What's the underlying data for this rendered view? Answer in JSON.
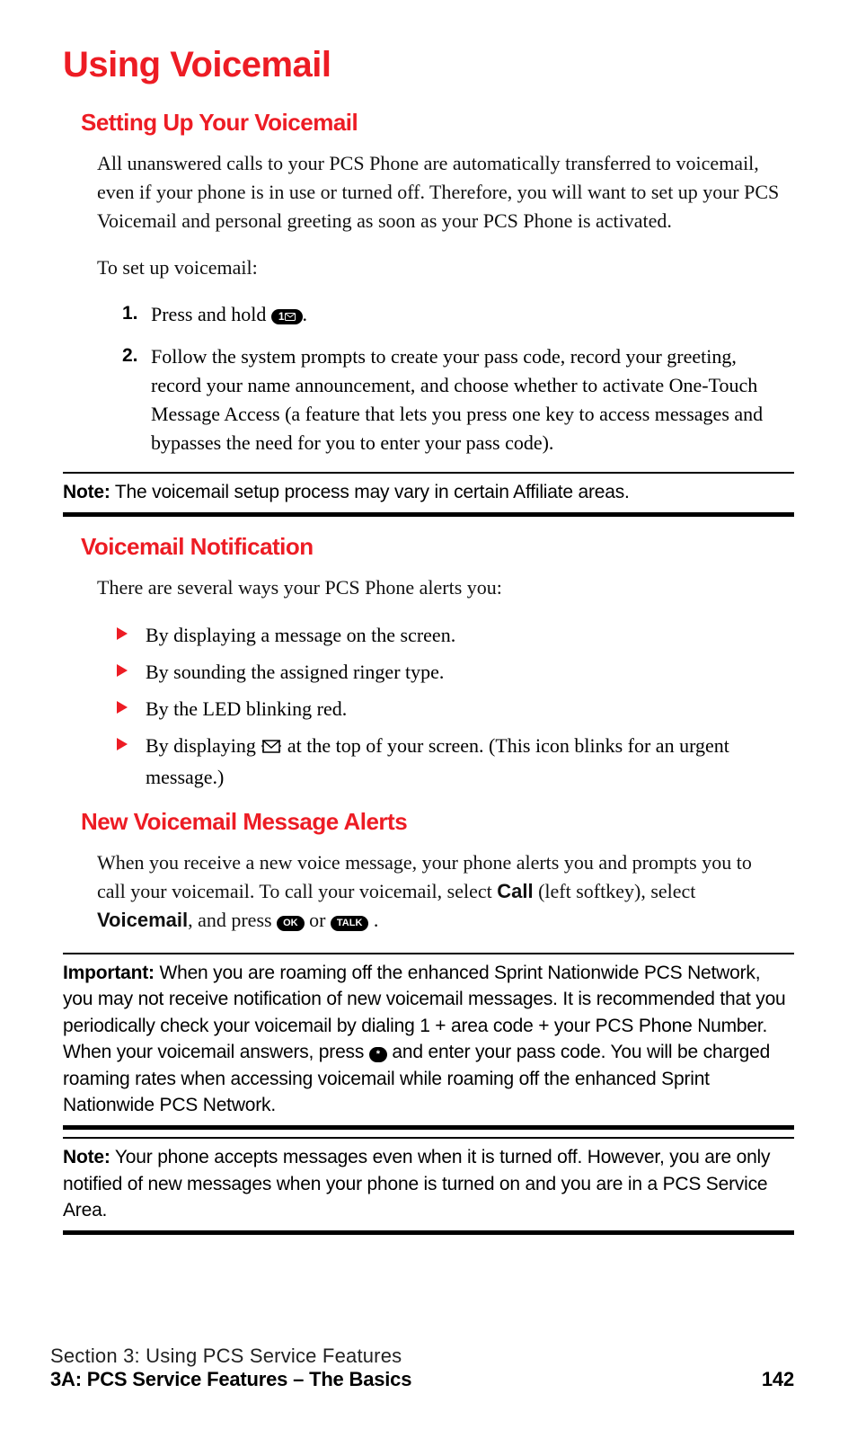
{
  "title": "Using Voicemail",
  "section1": {
    "heading": "Setting Up Your Voicemail",
    "intro": "All unanswered calls to your PCS Phone are automatically transferred to voicemail, even if your phone is in use or turned off. Therefore, you will want to set up your PCS Voicemail and personal greeting as soon as your PCS Phone is activated.",
    "lead": "To set up voicemail:",
    "steps": {
      "num1": "1.",
      "step1_a": "Press and hold ",
      "step1_key_label": "1",
      "step1_b": ".",
      "num2": "2.",
      "step2": "Follow the system prompts to create your pass code, record your greeting, record your name announcement, and choose whether to activate One-Touch Message Access (a feature that lets you press one key to access messages and bypasses the need for you to enter your pass code)."
    }
  },
  "note1": {
    "label": "Note:",
    "text": " The voicemail setup process may vary in certain Affiliate areas."
  },
  "section2": {
    "heading": "Voicemail Notification",
    "intro": "There are several ways your PCS Phone alerts you:",
    "items": {
      "i1": "By displaying a message on the screen.",
      "i2": "By sounding the assigned ringer type.",
      "i3": "By the LED blinking red.",
      "i4a": "By displaying ",
      "i4b": " at the top of your screen. (This icon blinks for an urgent message.)"
    }
  },
  "section3": {
    "heading": "New Voicemail Message Alerts",
    "p1a": "When you receive a new voice message, your phone alerts you and prompts you to call your voicemail. To call your voicemail, select ",
    "call": "Call",
    "p1b": " (left softkey), select ",
    "vm": "Voicemail",
    "p1c": ", and press ",
    "ok": "OK",
    "or": " or ",
    "talk": "TALK",
    "p1d": " ."
  },
  "important": {
    "label": "Important:",
    "t1": " When you are roaming off the enhanced Sprint Nationwide PCS Network, you may not receive notification of new voicemail messages. It is recommended that you periodically check your voicemail by dialing 1 + area code + your PCS Phone Number. When your voicemail answers, press ",
    "star": "*",
    "t2": " and enter your pass code. You will be charged roaming rates when accessing voicemail while roaming off the enhanced Sprint Nationwide PCS Network."
  },
  "note2": {
    "label": "Note:",
    "text": " Your phone accepts messages even when it is turned off. However, you are only notified of new messages when your phone is turned on and you are in a PCS Service Area."
  },
  "footer": {
    "section": "Section 3: Using PCS Service Features",
    "subsection": "3A: PCS Service Features – The Basics",
    "page": "142"
  }
}
